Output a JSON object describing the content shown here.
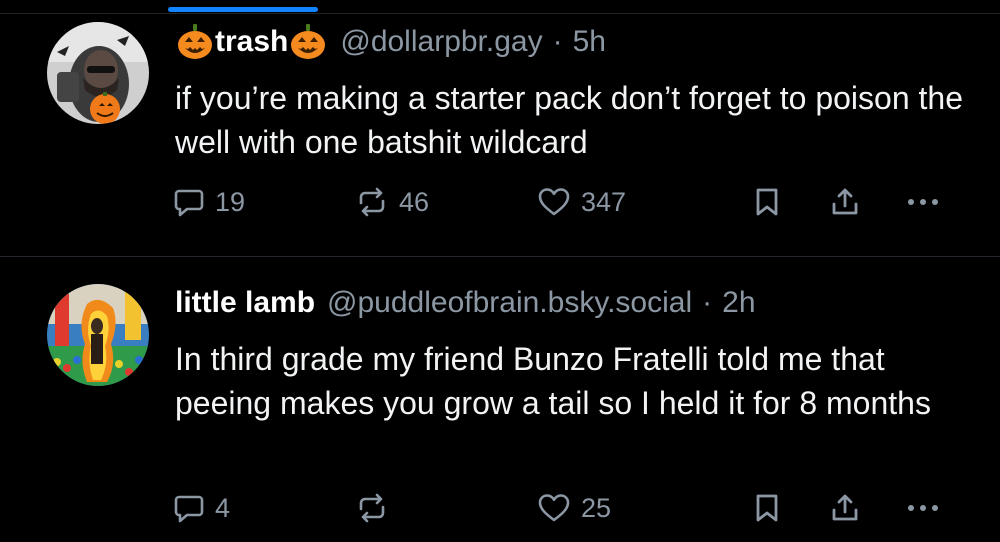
{
  "colors": {
    "background": "#000000",
    "accent": "#1083fe",
    "muted": "#8c97a4",
    "text": "#f1f3f5"
  },
  "posts": [
    {
      "author": {
        "display_name": "trash",
        "handle": "@dollarpbr.gay",
        "name_decoration": "jack-o-lantern-emoji"
      },
      "separator": "·",
      "time": "5h",
      "text": "if you’re making a starter pack don’t forget to poison the well with one batshit wildcard",
      "stats": {
        "replies": "19",
        "reposts": "46",
        "likes": "347"
      }
    },
    {
      "author": {
        "display_name": "little lamb",
        "handle": "@puddleofbrain.bsky.social"
      },
      "separator": "·",
      "time": "2h",
      "text": "In third grade my friend Bunzo Fratelli told me that peeing makes you grow a tail so I held it for 8 months",
      "stats": {
        "replies": "4",
        "reposts": "",
        "likes": "25"
      }
    }
  ]
}
